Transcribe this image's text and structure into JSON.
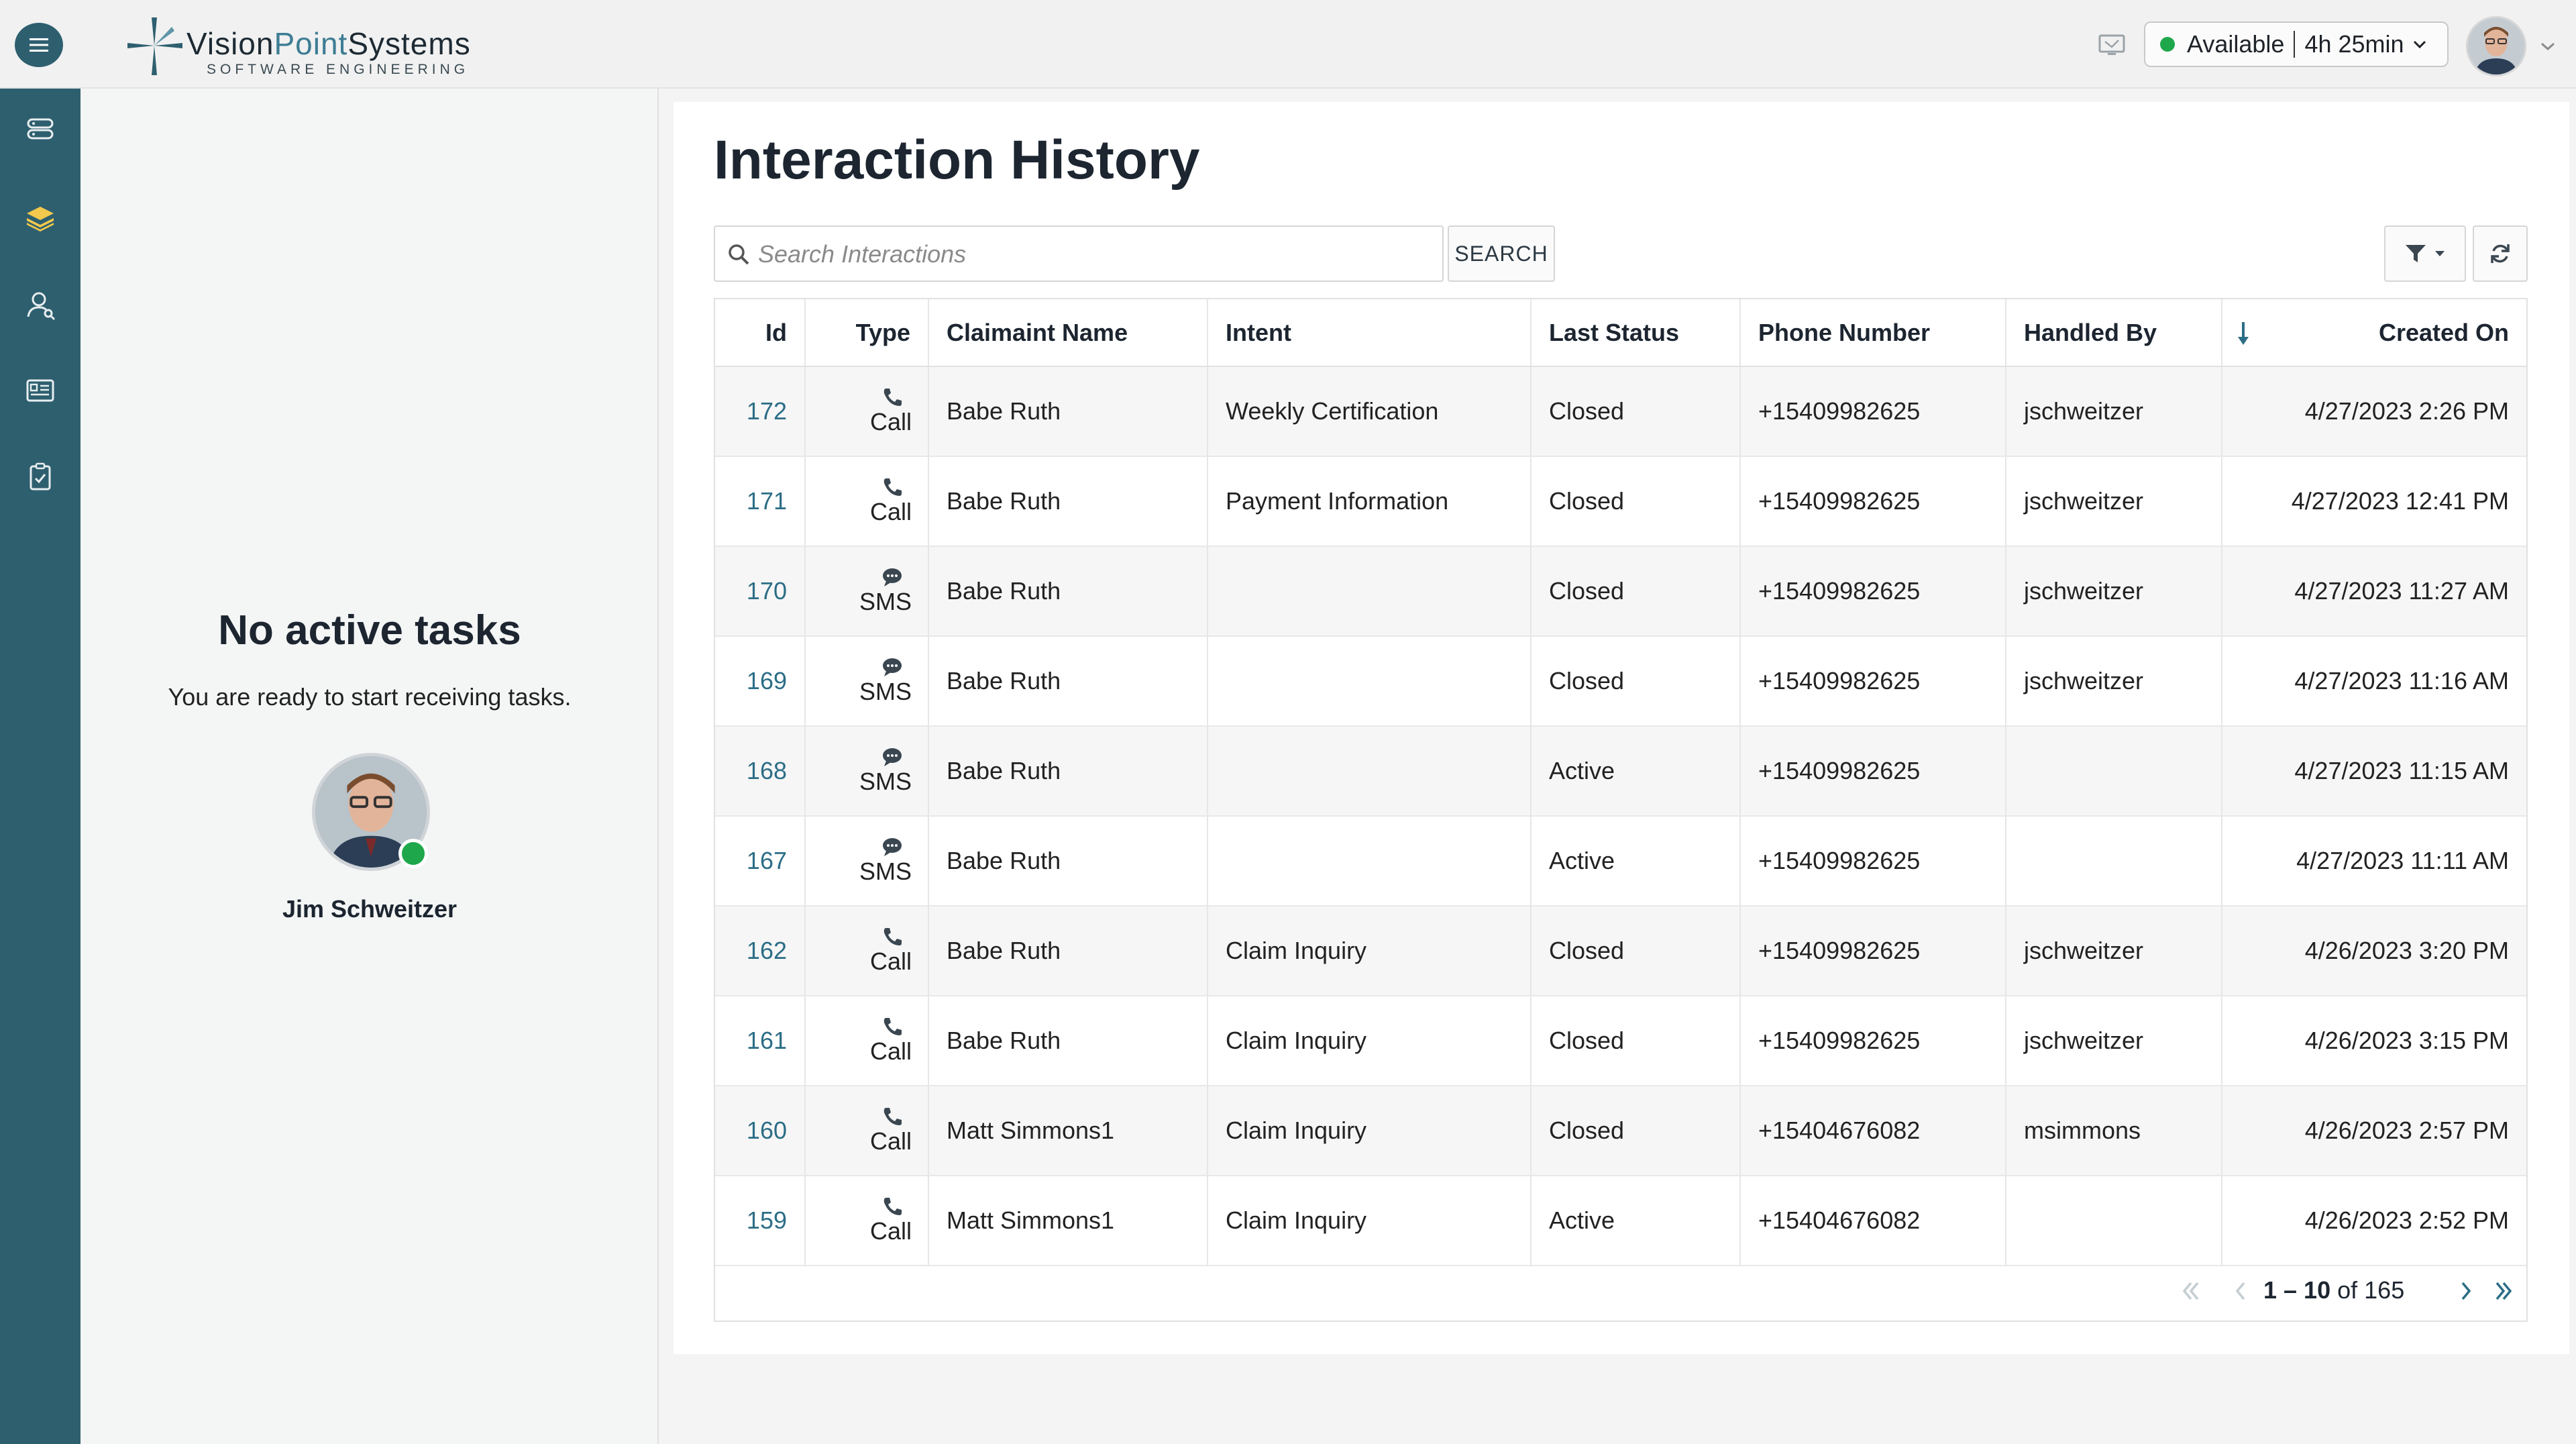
{
  "header": {
    "logo_text_a": "Vision",
    "logo_text_b": "Point",
    "logo_text_c": "Systems",
    "logo_subtitle": "SOFTWARE ENGINEERING",
    "status_label": "Available",
    "status_timer": "4h 25min",
    "status_color": "#1ea84b"
  },
  "rail": {
    "items": [
      {
        "name": "server-icon"
      },
      {
        "name": "layers-icon",
        "active": true
      },
      {
        "name": "contact-search-icon"
      },
      {
        "name": "id-card-icon"
      },
      {
        "name": "clipboard-check-icon"
      }
    ],
    "color": "#2e5f6f"
  },
  "tasks": {
    "title": "No active tasks",
    "subtitle": "You are ready to start receiving tasks.",
    "agent_name": "Jim Schweitzer"
  },
  "main": {
    "title": "Interaction History",
    "search_placeholder": "Search Interactions",
    "search_button": "SEARCH"
  },
  "table": {
    "columns": {
      "id": "Id",
      "type": "Type",
      "claimant": "Claimaint Name",
      "intent": "Intent",
      "status": "Last Status",
      "phone": "Phone Number",
      "handled": "Handled By",
      "created": "Created On"
    },
    "rows": [
      {
        "id": "172",
        "type": "Call",
        "claimant": "Babe Ruth",
        "intent": "Weekly Certification",
        "status": "Closed",
        "phone": "+15409982625",
        "handled": "jschweitzer",
        "created": "4/27/2023 2:26 PM"
      },
      {
        "id": "171",
        "type": "Call",
        "claimant": "Babe Ruth",
        "intent": "Payment Information",
        "status": "Closed",
        "phone": "+15409982625",
        "handled": "jschweitzer",
        "created": "4/27/2023 12:41 PM"
      },
      {
        "id": "170",
        "type": "SMS",
        "claimant": "Babe Ruth",
        "intent": "",
        "status": "Closed",
        "phone": "+15409982625",
        "handled": "jschweitzer",
        "created": "4/27/2023 11:27 AM"
      },
      {
        "id": "169",
        "type": "SMS",
        "claimant": "Babe Ruth",
        "intent": "",
        "status": "Closed",
        "phone": "+15409982625",
        "handled": "jschweitzer",
        "created": "4/27/2023 11:16 AM"
      },
      {
        "id": "168",
        "type": "SMS",
        "claimant": "Babe Ruth",
        "intent": "",
        "status": "Active",
        "phone": "+15409982625",
        "handled": "",
        "created": "4/27/2023 11:15 AM"
      },
      {
        "id": "167",
        "type": "SMS",
        "claimant": "Babe Ruth",
        "intent": "",
        "status": "Active",
        "phone": "+15409982625",
        "handled": "",
        "created": "4/27/2023 11:11 AM"
      },
      {
        "id": "162",
        "type": "Call",
        "claimant": "Babe Ruth",
        "intent": "Claim Inquiry",
        "status": "Closed",
        "phone": "+15409982625",
        "handled": "jschweitzer",
        "created": "4/26/2023 3:20 PM"
      },
      {
        "id": "161",
        "type": "Call",
        "claimant": "Babe Ruth",
        "intent": "Claim Inquiry",
        "status": "Closed",
        "phone": "+15409982625",
        "handled": "jschweitzer",
        "created": "4/26/2023 3:15 PM"
      },
      {
        "id": "160",
        "type": "Call",
        "claimant": "Matt Simmons1",
        "intent": "Claim Inquiry",
        "status": "Closed",
        "phone": "+15404676082",
        "handled": "msimmons",
        "created": "4/26/2023 2:57 PM"
      },
      {
        "id": "159",
        "type": "Call",
        "claimant": "Matt Simmons1",
        "intent": "Claim Inquiry",
        "status": "Active",
        "phone": "+15404676082",
        "handled": "",
        "created": "4/26/2023 2:52 PM"
      }
    ]
  },
  "pagination": {
    "range": "1 – 10",
    "of_label": "of",
    "total": "165"
  },
  "colors": {
    "accent": "#2e5f6f",
    "link": "#2c6d86",
    "online": "#1ea84b"
  }
}
